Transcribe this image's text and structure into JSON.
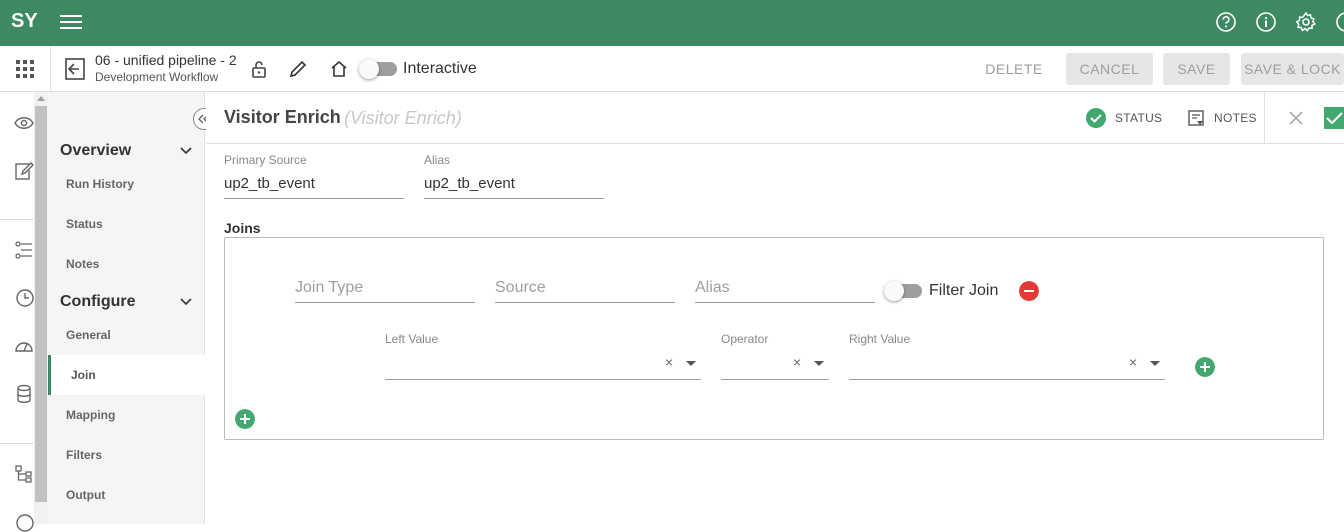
{
  "topbar": {
    "logo": "SY",
    "bg": "#3d8a62",
    "icons": [
      "menu-icon",
      "help-icon",
      "info-icon",
      "gear-icon",
      "user-icon"
    ]
  },
  "subbar": {
    "title": "06 - unified pipeline - 2",
    "subtitle": "Development Workflow",
    "toggle_label": "Interactive",
    "buttons": {
      "delete": "DELETE",
      "cancel": "CANCEL",
      "save": "SAVE",
      "save_lock": "SAVE & LOCK"
    }
  },
  "sidenav": {
    "overview": "Overview",
    "overview_items": [
      "Run History",
      "Status",
      "Notes"
    ],
    "configure": "Configure",
    "configure_items": [
      "General",
      "Join",
      "Mapping",
      "Filters",
      "Output"
    ],
    "active": "Join"
  },
  "header": {
    "title": "Visitor Enrich",
    "subtitle": "(Visitor Enrich)",
    "status_label": "STATUS",
    "notes_label": "NOTES"
  },
  "form": {
    "primary_source_label": "Primary Source",
    "primary_source_value": "up2_tb_event",
    "alias_label": "Alias",
    "alias_value": "up2_tb_event",
    "joins_title": "Joins",
    "join_type_placeholder": "Join Type",
    "source_placeholder": "Source",
    "alias_placeholder": "Alias",
    "filter_join_label": "Filter Join",
    "left_value_label": "Left Value",
    "operator_label": "Operator",
    "right_value_label": "Right Value",
    "clear_symbol": "×"
  },
  "colors": {
    "accent": "#3d8a62",
    "success": "#43a870",
    "danger": "#e53935"
  }
}
